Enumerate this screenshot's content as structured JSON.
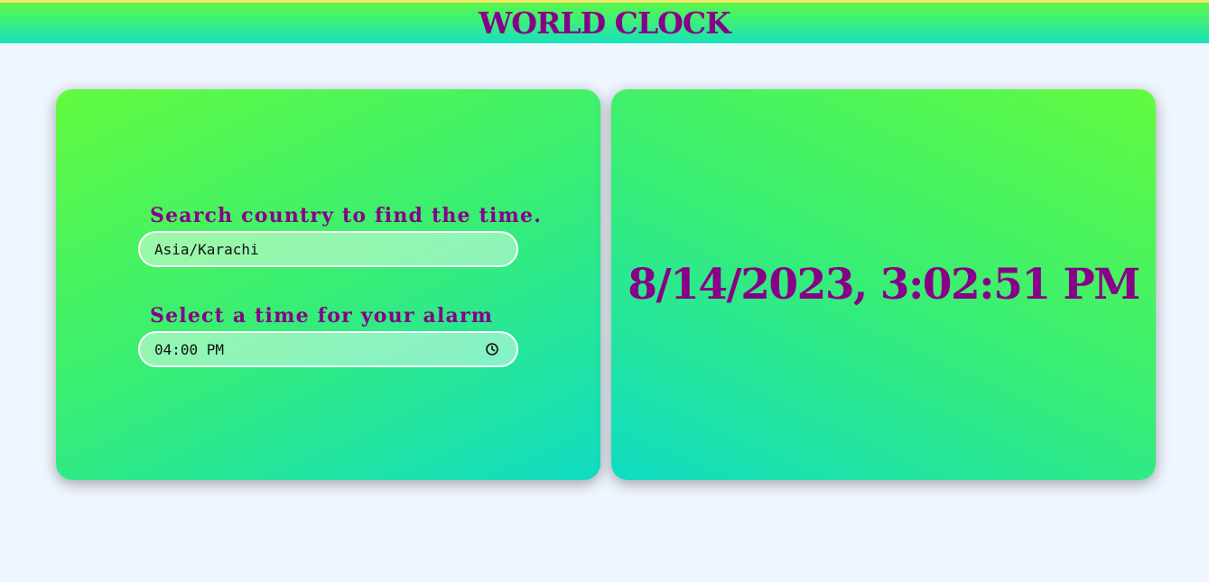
{
  "header": {
    "title": "WORLD CLOCK"
  },
  "search": {
    "label": "Search country to find the time.",
    "value": "Asia/Karachi"
  },
  "alarm": {
    "label": "Select a time for your alarm",
    "value": "04:00 PM",
    "icon": "clock-icon"
  },
  "display": {
    "datetime": "8/14/2023, 3:02:51 PM"
  },
  "colors": {
    "text_accent": "#870087",
    "gradient_green": "#62fb3f",
    "gradient_teal": "#10dcc3",
    "background": "#f0f6ff"
  }
}
